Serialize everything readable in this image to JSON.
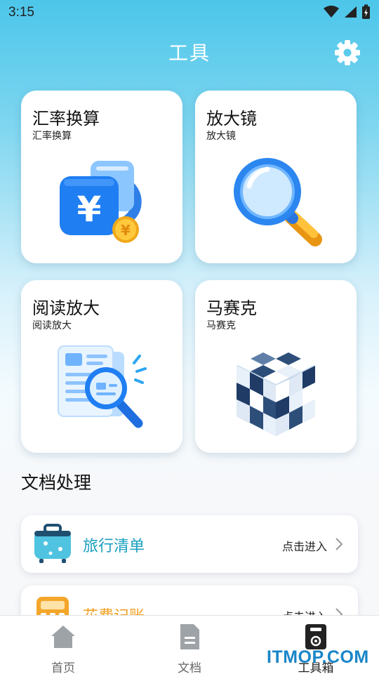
{
  "status_bar": {
    "time": "3:15"
  },
  "header": {
    "title": "工具"
  },
  "tool_cards": [
    {
      "title": "汇率换算",
      "subtitle": "汇率换算",
      "icon": "currency-exchange-icon"
    },
    {
      "title": "放大镜",
      "subtitle": "放大镜",
      "icon": "magnifier-icon"
    },
    {
      "title": "阅读放大",
      "subtitle": "阅读放大",
      "icon": "reading-zoom-icon"
    },
    {
      "title": "马赛克",
      "subtitle": "马赛克",
      "icon": "mosaic-cube-icon"
    }
  ],
  "section": {
    "title": "文档处理"
  },
  "doc_items": [
    {
      "label": "旅行清单",
      "action": "点击进入",
      "color": "#1a9fc0",
      "icon": "suitcase-icon"
    },
    {
      "label": "花费记账",
      "action": "点击进入",
      "color": "#f0a020",
      "icon": "calculator-icon"
    }
  ],
  "bottom_nav": [
    {
      "label": "首页",
      "icon": "home-icon"
    },
    {
      "label": "文档",
      "icon": "document-icon"
    },
    {
      "label": "工具箱",
      "icon": "toolbox-icon",
      "active": true
    }
  ],
  "watermark": "ITMOP.COM",
  "colors": {
    "accent": "#4cc6ea",
    "card_bg": "#ffffff"
  }
}
